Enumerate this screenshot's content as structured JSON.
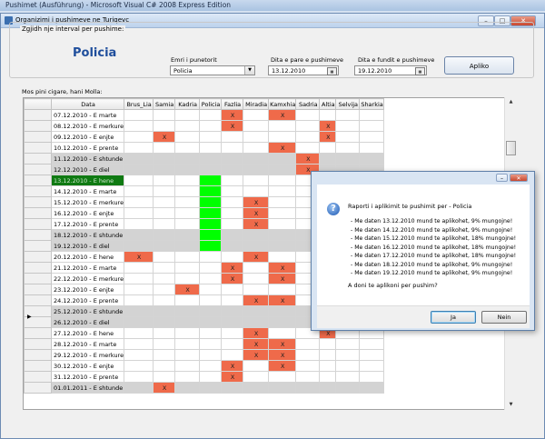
{
  "ide": {
    "title": "Pushimet (Ausführung) - Microsoft Visual C# 2008 Express Edition"
  },
  "app": {
    "title": "Organizimi i pushimeve ne Turiqevc",
    "minimize": "–",
    "maximize": "□",
    "close": "✕"
  },
  "form": {
    "group_label": "Zgjidh nje interval per pushime:",
    "unit_label": "Policia",
    "employee_label": "Emri i punetorit",
    "employee_value": "Policia",
    "start_label": "Dita e pare e pushimeve",
    "start_value": "13.12.2010",
    "end_label": "Dita e fundit e pushimeve",
    "end_value": "19.12.2010",
    "apply_button": "Apliko",
    "subtitle": "Mos pini cigare, hani Molla:"
  },
  "grid": {
    "columns": [
      "Data",
      "Brus_Lia",
      "Samia",
      "Kadria",
      "Policia",
      "Fazlia",
      "Miradia",
      "Kamxhia",
      "Sadria",
      "Altia",
      "Selvija",
      "Sharkia"
    ],
    "rows": [
      {
        "date": "07.12.2010 - E marte",
        "weekend": false,
        "x": [
          5,
          7
        ]
      },
      {
        "date": "08.12.2010 - E merkure",
        "weekend": false,
        "x": [
          5,
          9
        ]
      },
      {
        "date": "09.12.2010 - E enjte",
        "weekend": false,
        "x": [
          2,
          9
        ]
      },
      {
        "date": "10.12.2010 - E prente",
        "weekend": false,
        "x": [
          7
        ]
      },
      {
        "date": "11.12.2010 - E shtunde",
        "weekend": true,
        "x": [
          8
        ]
      },
      {
        "date": "12.12.2010 - E diel",
        "weekend": true,
        "x": [
          8
        ]
      },
      {
        "date": "13.12.2010 - E hene",
        "weekend": false,
        "x": [],
        "selected": true,
        "green": true
      },
      {
        "date": "14.12.2010 - E marte",
        "weekend": false,
        "x": [],
        "green": true
      },
      {
        "date": "15.12.2010 - E merkure",
        "weekend": false,
        "x": [
          6
        ],
        "green": true
      },
      {
        "date": "16.12.2010 - E enjte",
        "weekend": false,
        "x": [
          6
        ],
        "green": true
      },
      {
        "date": "17.12.2010 - E prente",
        "weekend": false,
        "x": [
          6
        ],
        "green": true
      },
      {
        "date": "18.12.2010 - E shtunde",
        "weekend": true,
        "x": [],
        "green": true
      },
      {
        "date": "19.12.2010 - E diel",
        "weekend": true,
        "x": [],
        "green": true
      },
      {
        "date": "20.12.2010 - E hene",
        "weekend": false,
        "x": [
          1,
          6
        ]
      },
      {
        "date": "21.12.2010 - E marte",
        "weekend": false,
        "x": [
          5,
          7
        ]
      },
      {
        "date": "22.12.2010 - E merkure",
        "weekend": false,
        "x": [
          5,
          7
        ]
      },
      {
        "date": "23.12.2010 - E enjte",
        "weekend": false,
        "x": [
          3
        ]
      },
      {
        "date": "24.12.2010 - E prente",
        "weekend": false,
        "x": [
          6,
          7
        ]
      },
      {
        "date": "25.12.2010 - E shtunde",
        "weekend": true,
        "x": []
      },
      {
        "date": "26.12.2010 - E diel",
        "weekend": true,
        "x": []
      },
      {
        "date": "27.12.2010 - E hene",
        "weekend": false,
        "x": [
          6,
          9
        ]
      },
      {
        "date": "28.12.2010 - E marte",
        "weekend": false,
        "x": [
          6,
          7
        ]
      },
      {
        "date": "29.12.2010 - E merkure",
        "weekend": false,
        "x": [
          6,
          7
        ]
      },
      {
        "date": "30.12.2010 - E enjte",
        "weekend": false,
        "x": [
          5,
          7
        ]
      },
      {
        "date": "31.12.2010 - E prente",
        "weekend": false,
        "x": [
          5
        ]
      },
      {
        "date": "01.01.2011 - E shtunde",
        "weekend": true,
        "x": [
          2
        ]
      }
    ],
    "mark": "X",
    "current_row_marker": "▶"
  },
  "dialog": {
    "title": "Raporti i aplikimit te pushimit per - Policia",
    "lines": [
      "- Me daten 13.12.2010 mund te aplikohet, 9% mungojne!",
      "- Me daten 14.12.2010 mund te aplikohet, 9% mungojne!",
      "- Me daten 15.12.2010 mund te aplikohet, 18% mungojne!",
      "- Me daten 16.12.2010 mund te aplikohet, 18% mungojne!",
      "- Me daten 17.12.2010 mund te aplikohet, 18% mungojne!",
      "- Me daten 18.12.2010 mund te aplikohet, 9% mungojne!",
      "- Me daten 19.12.2010 mund te aplikohet, 9% mungojne!"
    ],
    "question": "A doni te aplikoni per pushim?",
    "yes": "Ja",
    "no": "Nein",
    "icon": "question-icon"
  }
}
